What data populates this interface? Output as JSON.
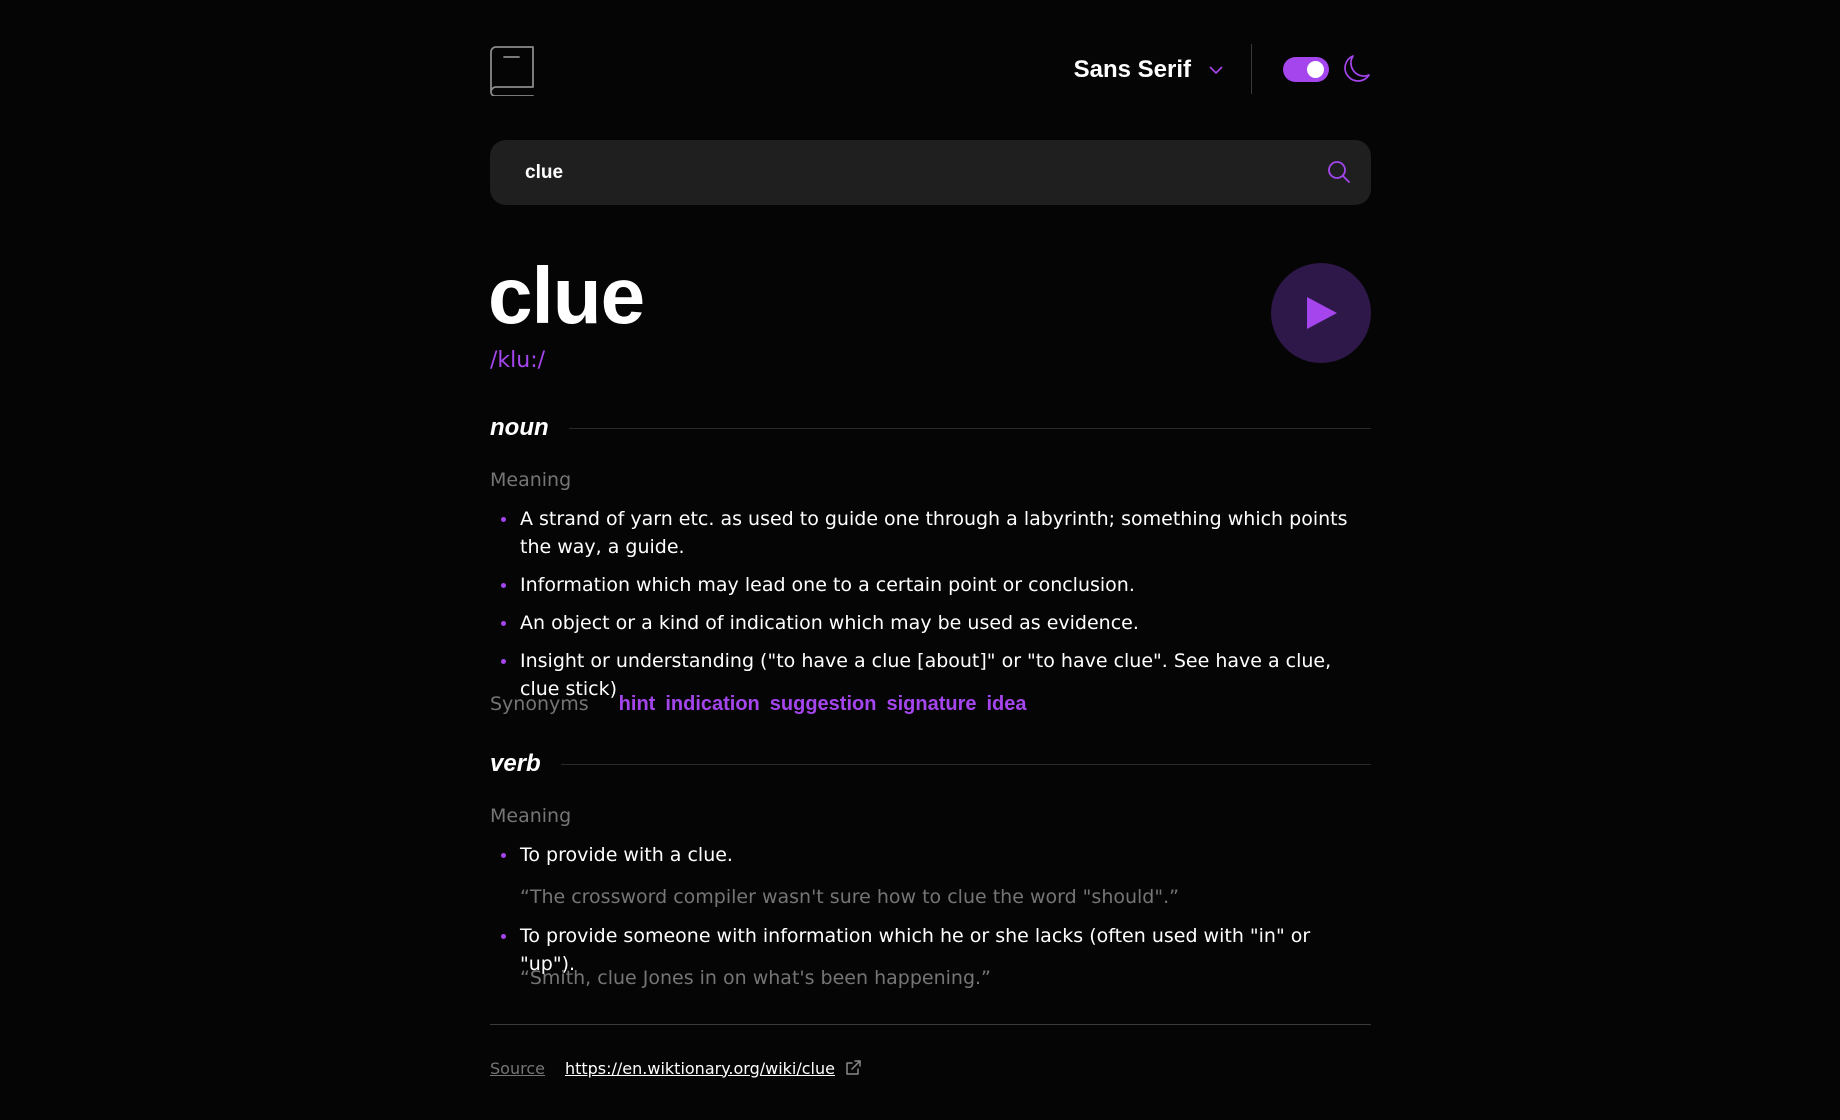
{
  "header": {
    "font_label": "Sans Serif",
    "theme_toggle_on": true,
    "accent": "#a445ed"
  },
  "search": {
    "value": "clue",
    "placeholder": "Search for any word…"
  },
  "entry": {
    "word": "clue",
    "phonetic": "/klu:/"
  },
  "meanings": [
    {
      "part_of_speech": "noun",
      "heading": "Meaning",
      "definitions": [
        {
          "text": "A strand of yarn etc. as used to guide one through a labyrinth; something which points the way, a guide."
        },
        {
          "text": "Information which may lead one to a certain point or conclusion."
        },
        {
          "text": "An object or a kind of indication which may be used as evidence."
        },
        {
          "text": "Insight or understanding (\"to have a clue [about]\" or \"to have clue\". See have a clue, clue stick)"
        }
      ],
      "synonyms_heading": "Synonyms",
      "synonyms": [
        "hint",
        "indication",
        "suggestion",
        "signature",
        "idea"
      ]
    },
    {
      "part_of_speech": "verb",
      "heading": "Meaning",
      "definitions": [
        {
          "text": "To provide with a clue.",
          "example": "“The crossword compiler wasn't sure how to clue the word \"should\".”"
        },
        {
          "text": "To provide someone with information which he or she lacks (often used with \"in\" or \"up\").",
          "example": "“Smith, clue Jones in on what's been happening.”"
        }
      ]
    }
  ],
  "source": {
    "label": "Source",
    "url": "https://en.wiktionary.org/wiki/clue"
  },
  "icons": [
    "book-logo-icon",
    "chevron-down-icon",
    "moon-icon",
    "search-icon",
    "play-icon",
    "external-link-icon"
  ]
}
